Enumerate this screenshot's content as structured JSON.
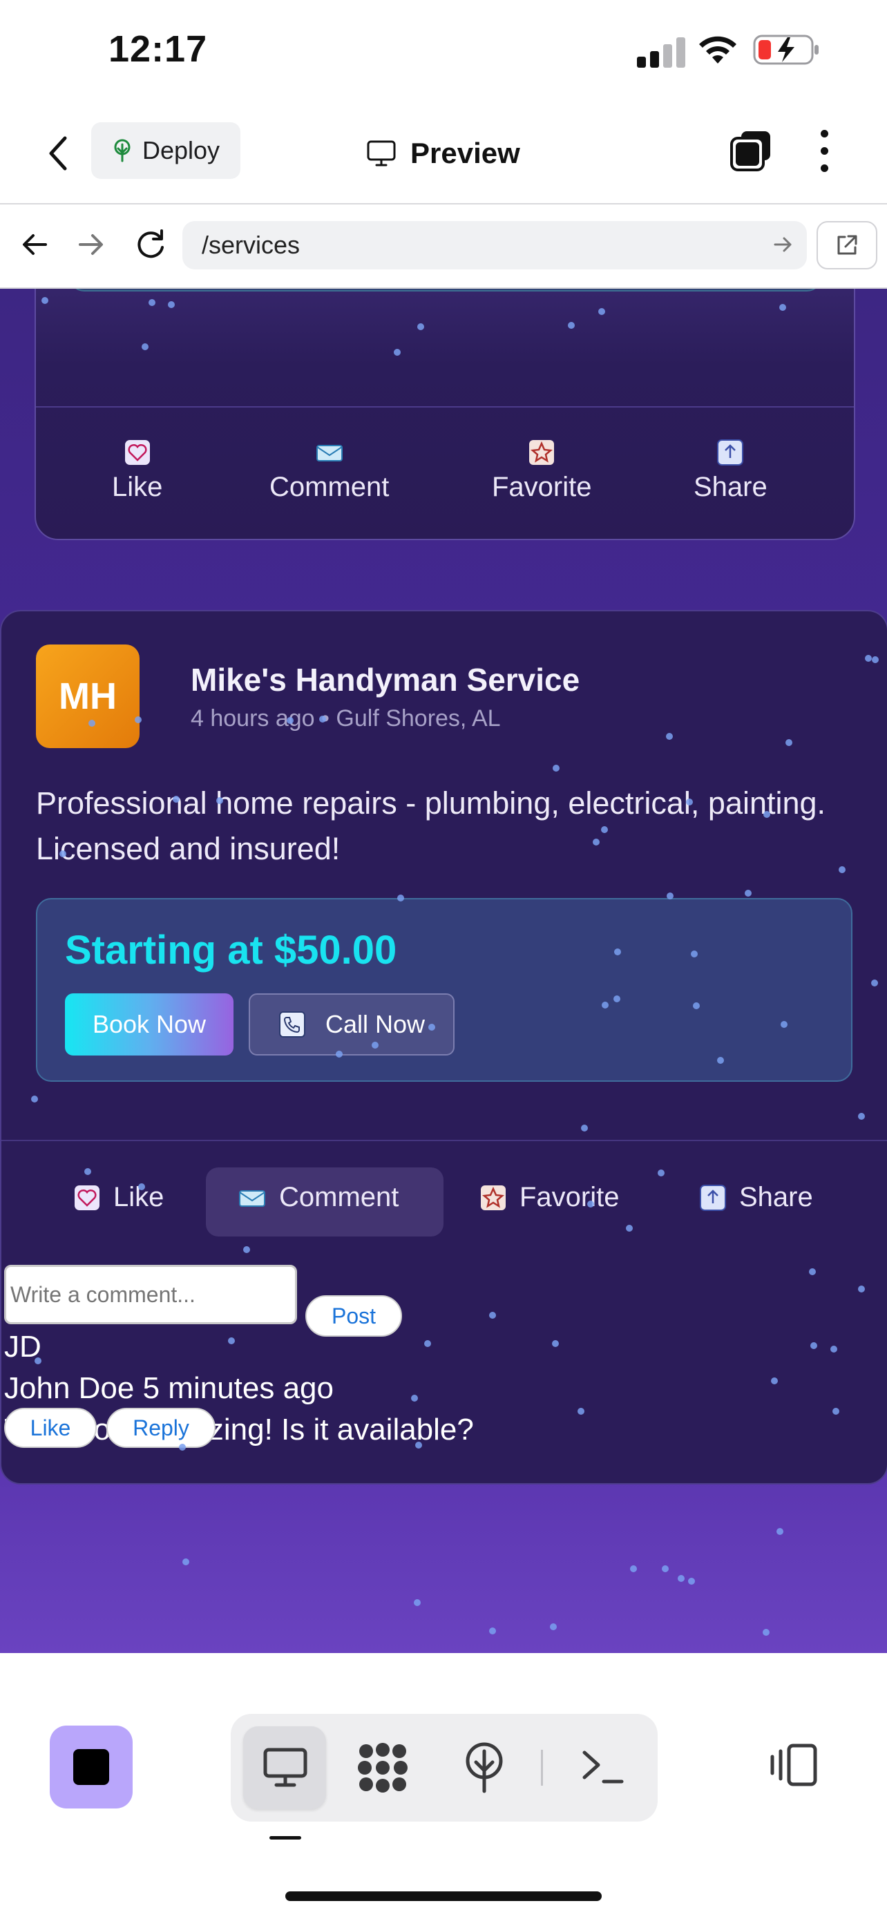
{
  "status_bar": {
    "time": "12:17"
  },
  "app_header": {
    "deploy_label": "Deploy",
    "title": "Preview"
  },
  "browser": {
    "url": "/services"
  },
  "prev_post": {
    "actions": [
      {
        "label": "Like",
        "icon": "heart-icon"
      },
      {
        "label": "Comment",
        "icon": "envelope-icon"
      },
      {
        "label": "Favorite",
        "icon": "star-icon"
      },
      {
        "label": "Share",
        "icon": "share-icon"
      }
    ]
  },
  "post": {
    "avatar_initials": "MH",
    "name": "Mike's Handyman Service",
    "time": "4 hours ago",
    "location": "Gulf Shores, AL",
    "text": "Professional home repairs - plumbing, electrical, painting. Licensed and insured!",
    "price": "Starting at $50.00",
    "book_label": "Book Now",
    "call_label": "Call Now",
    "actions": [
      {
        "label": "Like",
        "icon": "heart-icon"
      },
      {
        "label": "Comment",
        "icon": "envelope-icon"
      },
      {
        "label": "Favorite",
        "icon": "star-icon"
      },
      {
        "label": "Share",
        "icon": "share-icon"
      }
    ],
    "comment_placeholder": "Write a comment...",
    "post_label": "Post",
    "comment": {
      "initials": "JD",
      "author": "John Doe",
      "time": "5 minutes ago",
      "text": "This looks amazing! Is it available?",
      "like_label": "Like",
      "reply_label": "Reply"
    }
  },
  "colors": {
    "accent_cyan": "#19e3f0",
    "stop_button": "#b9a6fb",
    "avatar_orange": "#f7a41c"
  }
}
